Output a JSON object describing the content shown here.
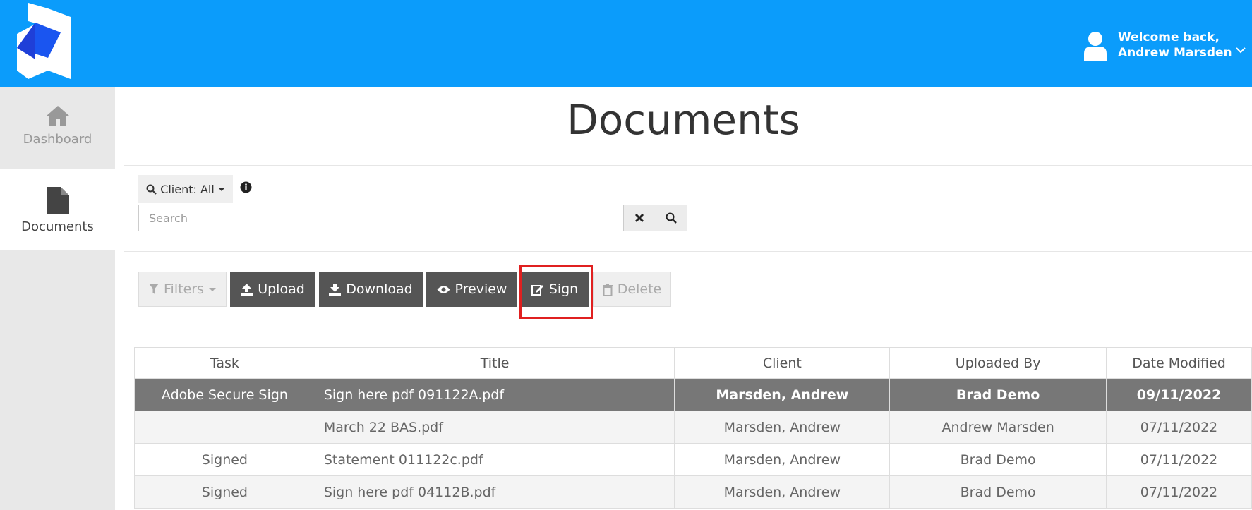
{
  "header": {
    "welcome_line1": "Welcome back,",
    "welcome_line2": "Andrew Marsden",
    "brand_color": "#0b9cfb"
  },
  "sidebar": {
    "items": [
      {
        "label": "Dashboard",
        "icon": "home-icon"
      },
      {
        "label": "Documents",
        "icon": "document-icon",
        "active": true
      }
    ]
  },
  "page": {
    "title": "Documents"
  },
  "search": {
    "client_filter": "Client: All",
    "placeholder": "Search"
  },
  "toolbar": {
    "filters": "Filters",
    "upload": "Upload",
    "download": "Download",
    "preview": "Preview",
    "sign": "Sign",
    "delete": "Delete"
  },
  "table": {
    "headers": [
      "Task",
      "Title",
      "Client",
      "Uploaded By",
      "Date Modified"
    ],
    "rows": [
      [
        "Adobe Secure Sign",
        "Sign here pdf 091122A.pdf",
        "Marsden, Andrew",
        "Brad Demo",
        "09/11/2022"
      ],
      [
        "",
        "March 22 BAS.pdf",
        "Marsden, Andrew",
        "Andrew Marsden",
        "07/11/2022"
      ],
      [
        "Signed",
        "Statement 011122c.pdf",
        "Marsden, Andrew",
        "Brad Demo",
        "07/11/2022"
      ],
      [
        "Signed",
        "Sign here pdf 04112B.pdf",
        "Marsden, Andrew",
        "Brad Demo",
        "07/11/2022"
      ]
    ]
  }
}
